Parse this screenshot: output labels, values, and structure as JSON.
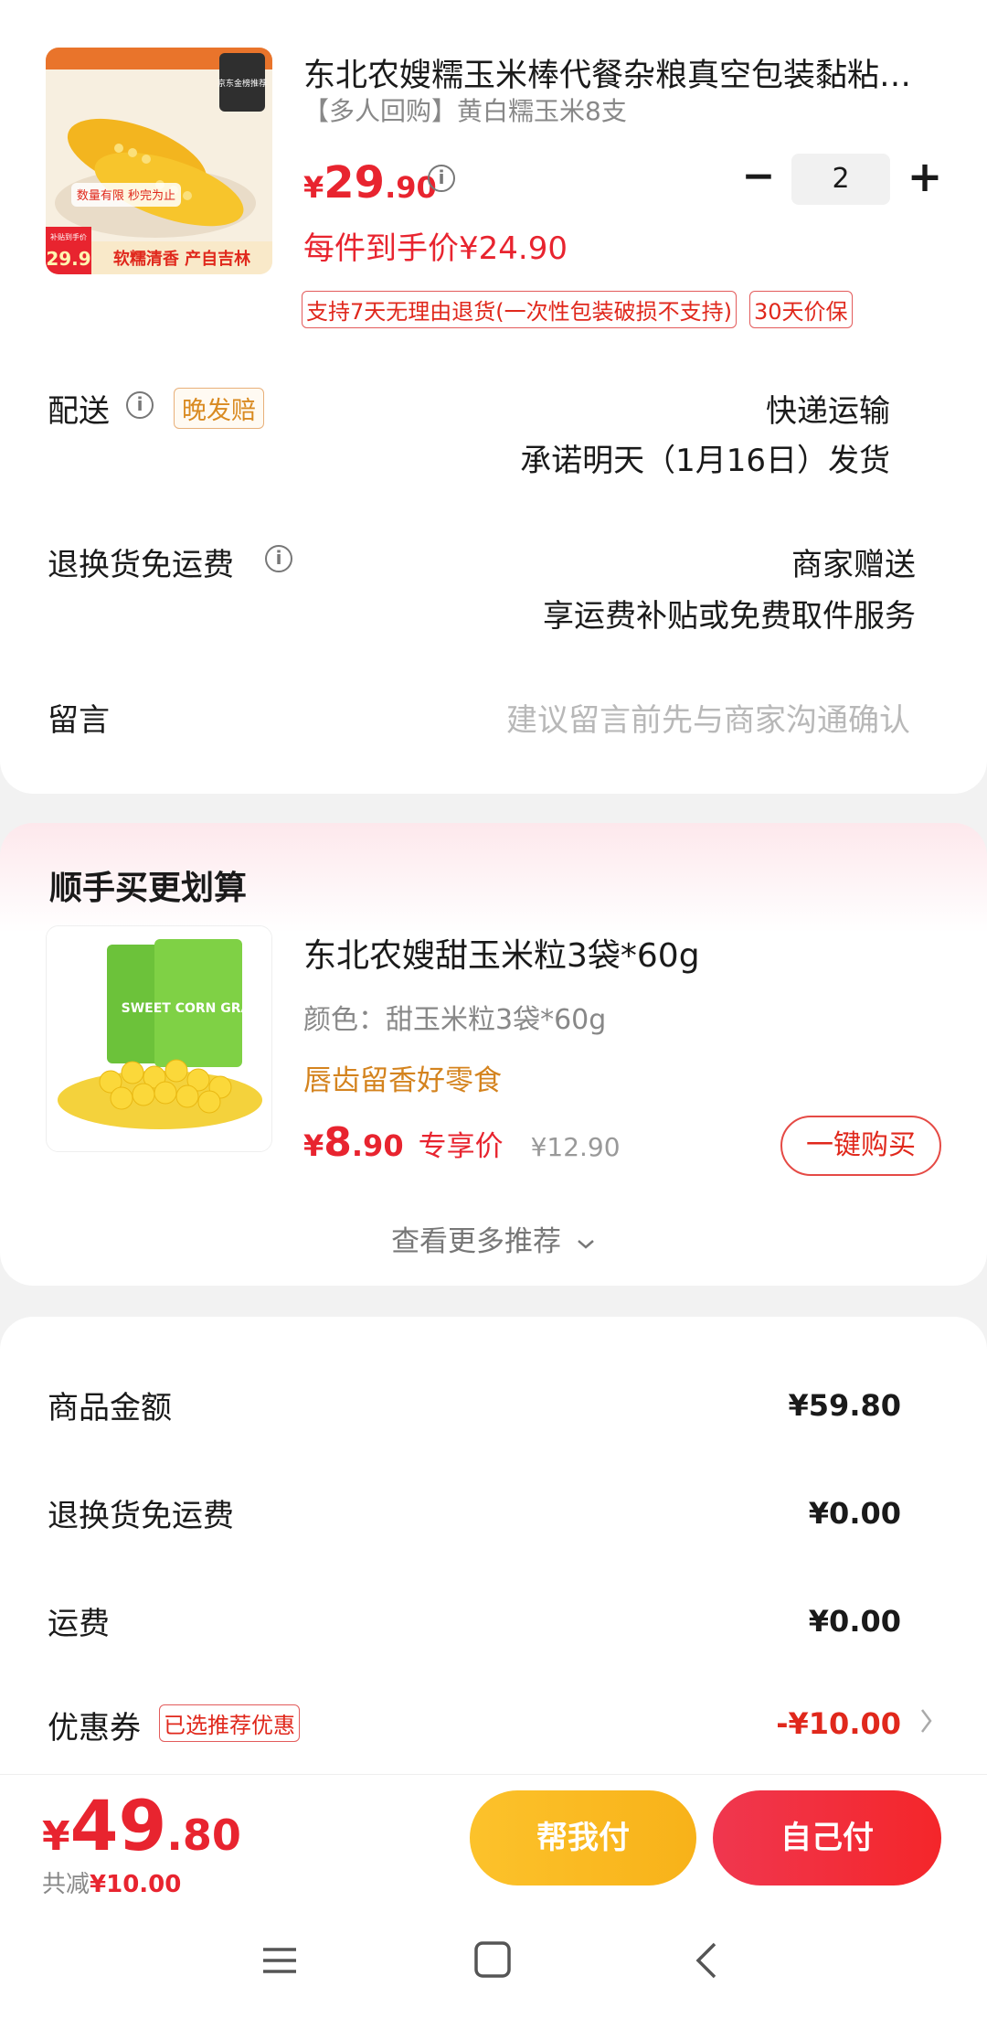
{
  "product": {
    "title": "东北农嫂糯玉米棒代餐杂粮真空包装黏粘…",
    "subtitle": "【多人回购】黄白糯玉米8支",
    "price_yen": "¥",
    "price_int": "29",
    "price_dec": ".90",
    "per_price": "每件到手价¥24.90",
    "quantity": "2",
    "tags": [
      "支持7天无理由退货(一次性包装破损不支持)",
      "30天价保"
    ],
    "image_badges": {
      "top": "京东金榜推荐",
      "promo": "数量有限 秒完为止",
      "subsidy": "补贴到手价",
      "subsidy_price": "29.9",
      "bottom": "软糯清香 产自吉林"
    }
  },
  "delivery": {
    "label": "配送",
    "tag": "晚发赔",
    "method": "快递运输",
    "promise": "承诺明天（1月16日）发货"
  },
  "returns": {
    "label": "退换货免运费",
    "value": "商家赠送",
    "desc": "享运费补贴或免费取件服务"
  },
  "message": {
    "label": "留言",
    "placeholder": "建议留言前先与商家沟通确认"
  },
  "recommend": {
    "section_title": "顺手买更划算",
    "title": "东北农嫂甜玉米粒3袋*60g",
    "spec": "颜色：甜玉米粒3袋*60g",
    "slogan": "唇齿留香好零食",
    "price_yen": "¥",
    "price_int": "8",
    "price_dec": ".90",
    "exclusive": "专享价",
    "original": "¥12.90",
    "buy_label": "一键购买",
    "more_label": "查看更多推荐",
    "image_text": "SWEET CORN GRAINS"
  },
  "summary": {
    "goods_label": "商品金额",
    "goods_value": "¥59.80",
    "return_label": "退换货免运费",
    "return_value": "¥0.00",
    "shipping_label": "运费",
    "shipping_value": "¥0.00",
    "coupon_label": "优惠券",
    "coupon_tag": "已选推荐优惠",
    "coupon_value": "-¥10.00"
  },
  "footer": {
    "total_yen": "¥",
    "total_int": "49",
    "total_dec": ".80",
    "saved_prefix": "共减",
    "saved_value": "¥10.00",
    "help_pay": "帮我付",
    "self_pay": "自己付"
  },
  "colors": {
    "accent_red": "#e8242f",
    "accent_yellow": "#fcc22b",
    "orange_text": "#d4831e"
  }
}
